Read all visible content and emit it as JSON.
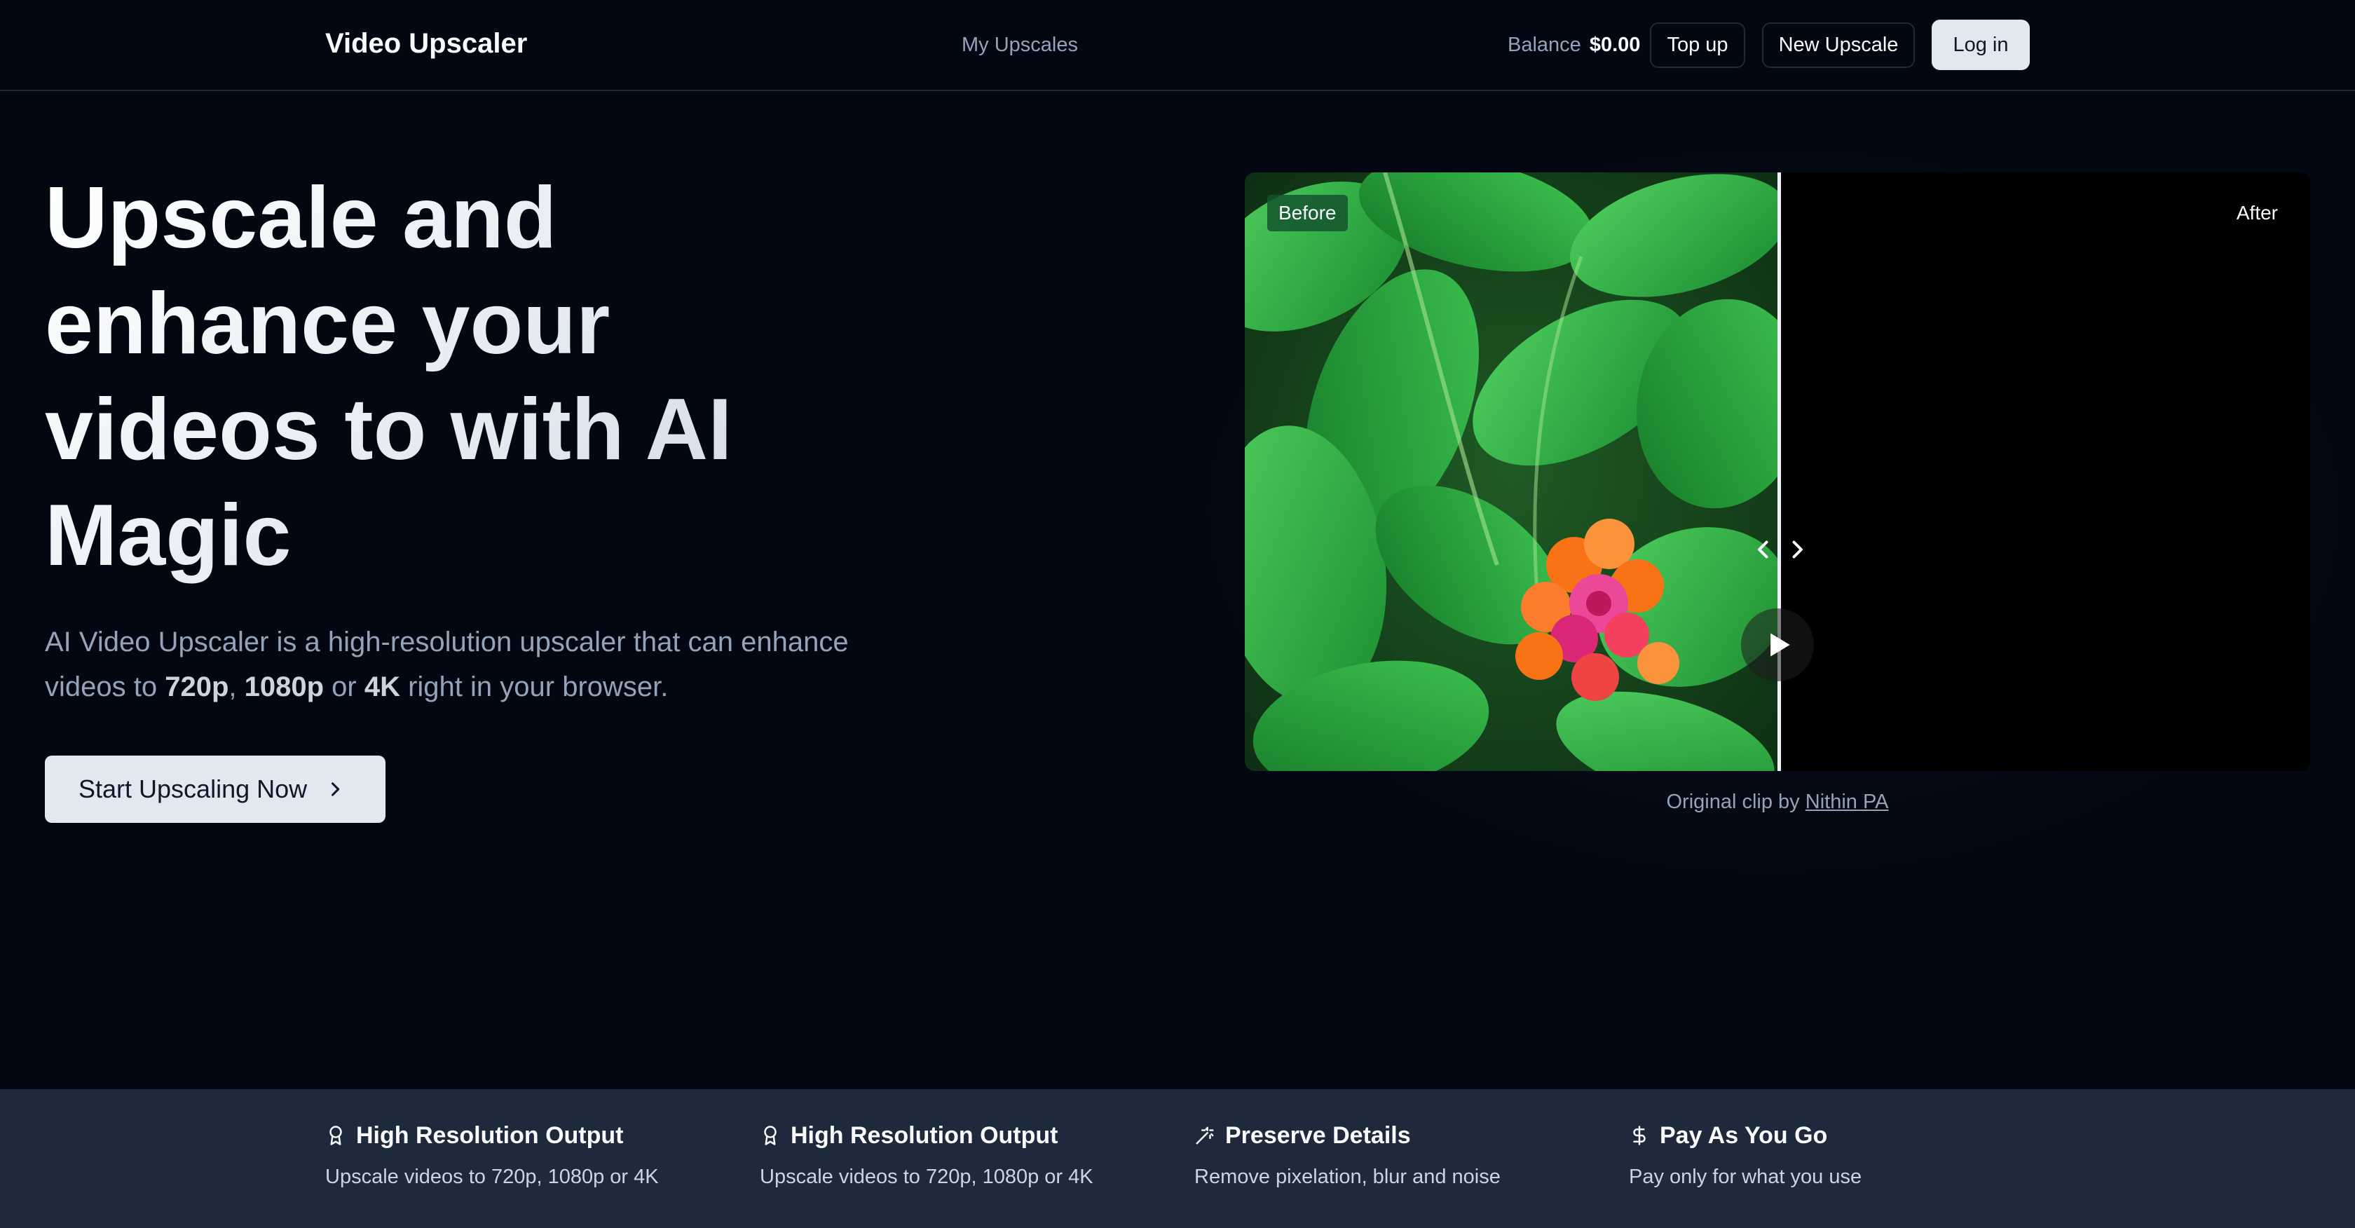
{
  "header": {
    "brand": "Video Upscaler",
    "nav_my_upscales": "My Upscales",
    "balance_label": "Balance",
    "balance_value": "$0.00",
    "top_up_label": "Top up",
    "new_upscale_label": "New Upscale",
    "login_label": "Log in"
  },
  "hero": {
    "title": "Upscale and enhance your videos to with AI Magic",
    "desc_part1": "AI Video Upscaler is a high-resolution upscaler that can enhance videos to ",
    "res1": "720p",
    "sep1": ", ",
    "res2": "1080p",
    "sep2": " or ",
    "res3": "4K",
    "desc_part2": " right in your browser.",
    "cta_label": "Start Upscaling Now"
  },
  "viewer": {
    "before_label": "Before",
    "after_label": "After",
    "credit_prefix": "Original clip by ",
    "credit_author": "Nithin PA"
  },
  "features": [
    {
      "icon": "award-icon",
      "title": "High Resolution Output",
      "desc": "Upscale videos to 720p, 1080p or 4K"
    },
    {
      "icon": "award-icon",
      "title": "High Resolution Output",
      "desc": "Upscale videos to 720p, 1080p or 4K"
    },
    {
      "icon": "magic-wand-icon",
      "title": "Preserve Details",
      "desc": "Remove pixelation, blur and noise"
    },
    {
      "icon": "dollar-icon",
      "title": "Pay As You Go",
      "desc": "Pay only for what you use"
    }
  ],
  "colors": {
    "background": "#030712",
    "border": "#1e293b",
    "muted_text": "#94a3b8",
    "light_button": "#e2e8f0",
    "feature_bar": "#1e293b",
    "before_tag": "#14532d"
  }
}
